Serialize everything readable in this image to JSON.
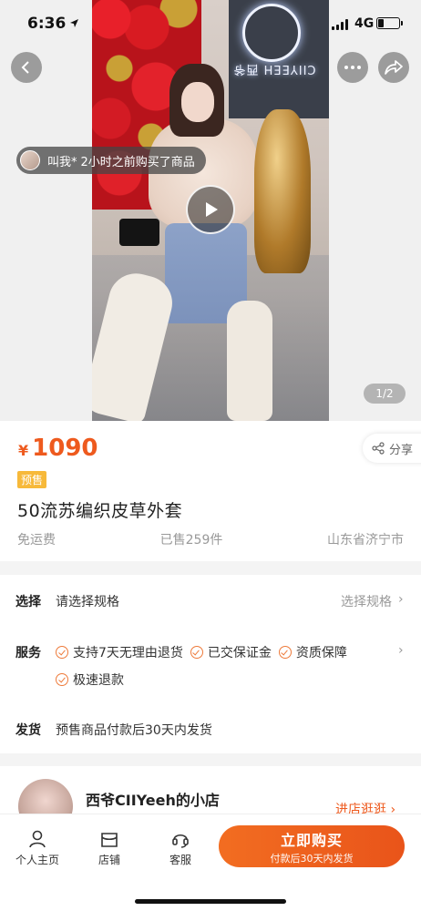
{
  "status_bar": {
    "time": "6:36",
    "network": "4G"
  },
  "media": {
    "toast": {
      "name": "叫我*",
      "text": "2小时之前购买了商品"
    },
    "logo_text": "CIIYEEH 西爷",
    "page_indicator": "1/2"
  },
  "product": {
    "price_symbol": "¥",
    "price": "1090",
    "badge": "预售",
    "title": "50流苏编织皮草外套",
    "shipping_fee": "免运费",
    "sold": "已售259件",
    "location": "山东省济宁市",
    "share_label": "分享"
  },
  "spec": {
    "select_label": "选择",
    "select_value": "请选择规格",
    "select_right": "选择规格",
    "service_label": "服务",
    "services": [
      "支持7天无理由退货",
      "已交保证金",
      "资质保障",
      "极速退款"
    ],
    "ship_label": "发货",
    "ship_value": "预售商品付款后30天内发货"
  },
  "shop": {
    "name": "西爷CIIYeeh的小店",
    "link": "进店逛逛"
  },
  "bottom": {
    "profile": "个人主页",
    "store": "店铺",
    "service": "客服",
    "buy_main": "立即购买",
    "buy_sub": "付款后30天内发货"
  }
}
